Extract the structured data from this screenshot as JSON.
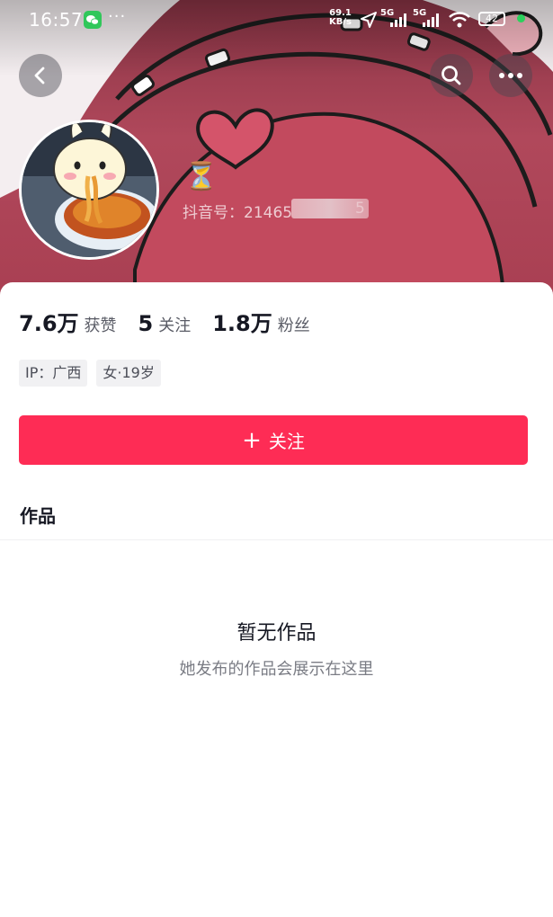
{
  "status_bar": {
    "time": "16:57",
    "more": "···",
    "net_speed_value": "69.1",
    "net_speed_unit": "KB/s",
    "signal_1": "5G",
    "signal_2": "5G",
    "battery": "42",
    "icons": [
      "wechat-icon",
      "location-arrow-icon",
      "signal-icon",
      "wifi-icon",
      "battery-icon"
    ]
  },
  "header": {
    "back_icon": "chevron-left-icon",
    "search_icon": "search-icon",
    "more_icon": "more-dots-icon"
  },
  "profile": {
    "nickname_emoji": "⏳",
    "douyin_id_label": "抖音号：",
    "douyin_id_visible": "21465",
    "douyin_id_tail": "5"
  },
  "stats": [
    {
      "value": "7.6万",
      "label": "获赞"
    },
    {
      "value": "5",
      "label": "关注"
    },
    {
      "value": "1.8万",
      "label": "粉丝"
    }
  ],
  "tags": [
    "IP：广西",
    "女·19岁"
  ],
  "follow_button": {
    "icon": "+",
    "label": "关注",
    "color": "#fe2c55"
  },
  "tabs": {
    "works": "作品"
  },
  "empty_state": {
    "title": "暂无作品",
    "subtitle": "她发布的作品会展示在这里"
  }
}
